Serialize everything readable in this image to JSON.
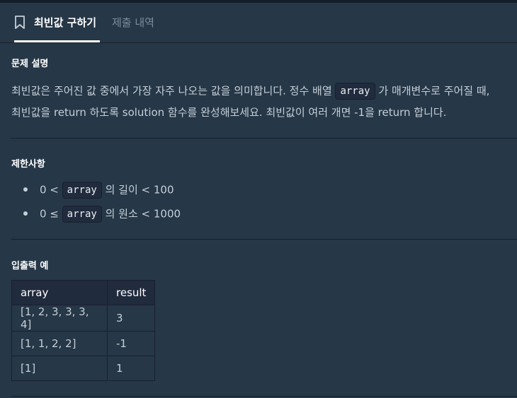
{
  "tabs": {
    "active": "최빈값 구하기",
    "inactive": "제출 내역"
  },
  "sections": {
    "description": {
      "title": "문제 설명",
      "line1_before": "최빈값은 주어진 값 중에서 가장 자주 나오는 값을 의미합니다. 정수 배열",
      "line1_code": "array",
      "line1_after": "가 매개변수로 주어질 때,",
      "line2": "최빈값을 return 하도록 solution 함수를 완성해보세요. 최빈값이 여러 개면 -1을 return 합니다."
    },
    "constraints": {
      "title": "제한사항",
      "items": [
        {
          "before": "0 <",
          "code": "array",
          "after": "의 길이 < 100"
        },
        {
          "before": "0 ≤",
          "code": "array",
          "after": "의 원소 < 1000"
        }
      ]
    },
    "examples": {
      "title": "입출력 예",
      "headers": [
        "array",
        "result"
      ],
      "rows": [
        [
          "[1, 2, 3, 3, 3, 4]",
          "3"
        ],
        [
          "[1, 1, 2, 2]",
          "-1"
        ],
        [
          "[1]",
          "1"
        ]
      ]
    }
  },
  "icons": {
    "bookmark": "bookmark-icon"
  },
  "colors": {
    "background": "#263747",
    "code_background": "#202b3d",
    "text": "#c5cfd8",
    "inactive_tab": "#7d8d9c"
  }
}
